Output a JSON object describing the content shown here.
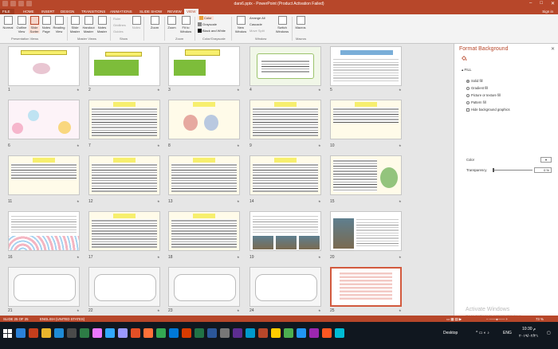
{
  "window": {
    "title": "dars6.pptx - PowerPoint (Product Activation Failed)",
    "minimize": "–",
    "maximize": "□",
    "close": "✕"
  },
  "tabs": {
    "file": "FILE",
    "home": "HOME",
    "insert": "INSERT",
    "design": "DESIGN",
    "transitions": "TRANSITIONS",
    "animations": "ANIMATIONS",
    "slide_show": "SLIDE SHOW",
    "review": "REVIEW",
    "view": "VIEW",
    "sign_in": "Sign in"
  },
  "ribbon": {
    "normal": "Normal",
    "outline_view": "Outline View",
    "slide_sorter": "Slide Sorter",
    "notes_page": "Notes Page",
    "reading_view": "Reading View",
    "slide_master": "Slide Master",
    "handout_master": "Handout Master",
    "notes_master": "Notes Master",
    "ruler": "Ruler",
    "gridlines": "Gridlines",
    "guides": "Guides",
    "notes": "Notes",
    "zoom": "Zoom",
    "fit_to_window": "Fit to Window",
    "color": "Color",
    "grayscale": "Grayscale",
    "black_and_white": "Black and White",
    "new_window": "New Window",
    "arrange_all": "Arrange All",
    "cascade": "Cascade",
    "move_split": "Move Split",
    "switch_windows": "Switch Windows",
    "macros": "Macros",
    "grp_presentation_views": "Presentation Views",
    "grp_master_views": "Master Views",
    "grp_show": "Show",
    "grp_zoom": "Zoom",
    "grp_color": "Color/Grayscale",
    "grp_window": "Window",
    "grp_macros": "Macros"
  },
  "slides": {
    "numbers": [
      "1",
      "2",
      "3",
      "4",
      "5",
      "6",
      "7",
      "8",
      "9",
      "10",
      "11",
      "12",
      "13",
      "14",
      "15",
      "16",
      "17",
      "18",
      "19",
      "20",
      "21",
      "22",
      "23",
      "24",
      "25"
    ],
    "selected": "25",
    "transition_mark": "★"
  },
  "pane": {
    "title": "Format Background",
    "close": "✕",
    "fill_header": "FILL",
    "solid_fill": "Solid fill",
    "gradient_fill": "Gradient fill",
    "picture_fill": "Picture or texture fill",
    "pattern_fill": "Pattern fill",
    "hide_bg": "Hide background graphics",
    "color_label": "Color",
    "transparency_label": "Transparency",
    "transparency_value": "0 %",
    "transparency_fraction": 0,
    "activate_title": "Activate Windows",
    "activate_sub": "Go to Settings to activate Windows.",
    "apply_all": "Apply to All",
    "reset_bg": "Reset Background",
    "colors": {
      "accent": "#b7472a"
    }
  },
  "status": {
    "slide_info": "SLIDE 25 OF 25",
    "language": "ENGLISH (UNITED STATES)",
    "zoom": "73 %"
  },
  "taskbar": {
    "desktop": "Desktop",
    "lang": "ENG",
    "time": "10:30 م",
    "date": "۲۰۱۹/۰۲/۲۱"
  }
}
